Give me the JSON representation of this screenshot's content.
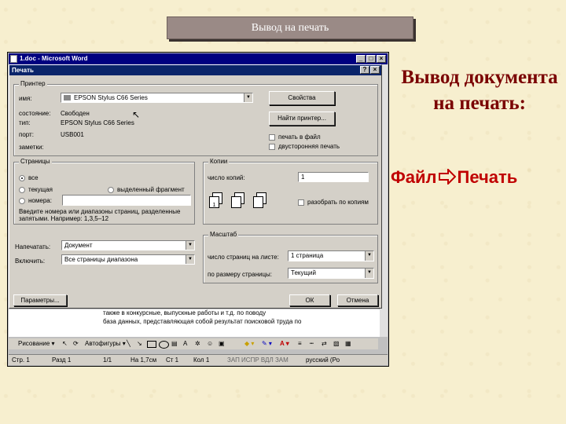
{
  "slide": {
    "title": "Вывод на печать",
    "heading": "Вывод документа на печать:",
    "path_from": "Файл",
    "path_to": "Печать"
  },
  "word": {
    "title": "1.doc - Microsoft Word",
    "dialog": {
      "title": "Печать",
      "printer": {
        "legend": "Принтер",
        "name_label": "имя:",
        "name_value": "EPSON Stylus C66 Series",
        "status_label": "состояние:",
        "status_value": "Свободен",
        "type_label": "тип:",
        "type_value": "EPSON Stylus C66 Series",
        "port_label": "порт:",
        "port_value": "USB001",
        "comment_label": "заметки:",
        "properties_button": "Свойства",
        "find_button": "Найти принтер...",
        "print_to_file": "печать в файл",
        "duplex": "двусторонняя печать"
      },
      "pages": {
        "legend": "Страницы",
        "all": "все",
        "current": "текущая",
        "selection": "выделенный фрагмент",
        "numbers": "номера:",
        "hint": "Введите номера или диапазоны страниц, разделенные запятыми. Например: 1,3,5–12"
      },
      "copies": {
        "legend": "Копии",
        "count_label": "число копий:",
        "count_value": "1",
        "collate": "разобрать по копиям"
      },
      "print_what_label": "Напечатать:",
      "print_what_value": "Документ",
      "include_label": "Включить:",
      "include_value": "Все страницы диапазона",
      "zoom": {
        "legend": "Масштаб",
        "pages_per_sheet_label": "число страниц на листе:",
        "pages_per_sheet_value": "1 страница",
        "scale_label": "по размеру страницы:",
        "scale_value": "Текущий"
      },
      "options_button": "Параметры...",
      "ok_button": "ОК",
      "cancel_button": "Отмена"
    },
    "doc_lines": [
      "также в конкурсные, выпускные работы и т.д. по поводу",
      "база данных, представляющая собой результат поисковой труда по"
    ],
    "toolbar": {
      "draw": "Рисование",
      "autoshapes": "Автофигуры"
    },
    "status": {
      "page": "Стр. 1",
      "section": "Разд 1",
      "pages": "1/1",
      "position": "На 1,7см",
      "line": "Ст 1",
      "column": "Кол 1",
      "modes": "ЗАП  ИСПР  ВДЛ  ЗАМ",
      "language": "русский (Ро"
    }
  }
}
